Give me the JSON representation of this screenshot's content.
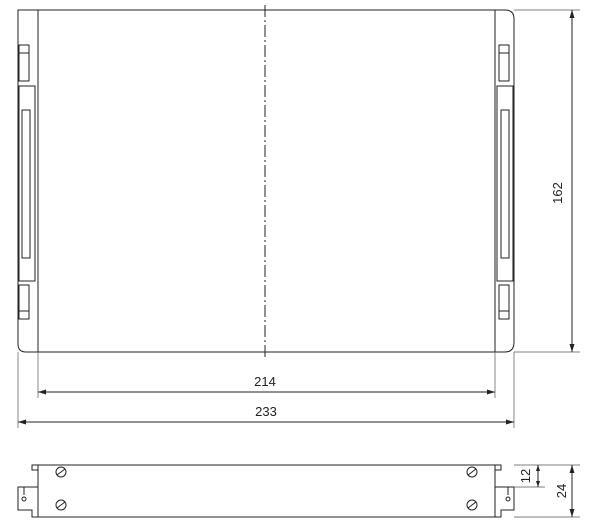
{
  "drawing": {
    "dimensions": {
      "inner_width": "214",
      "outer_width": "233",
      "height": "162",
      "side_small": "12",
      "side_total": "24"
    },
    "views": [
      "top-view",
      "side-view"
    ]
  }
}
